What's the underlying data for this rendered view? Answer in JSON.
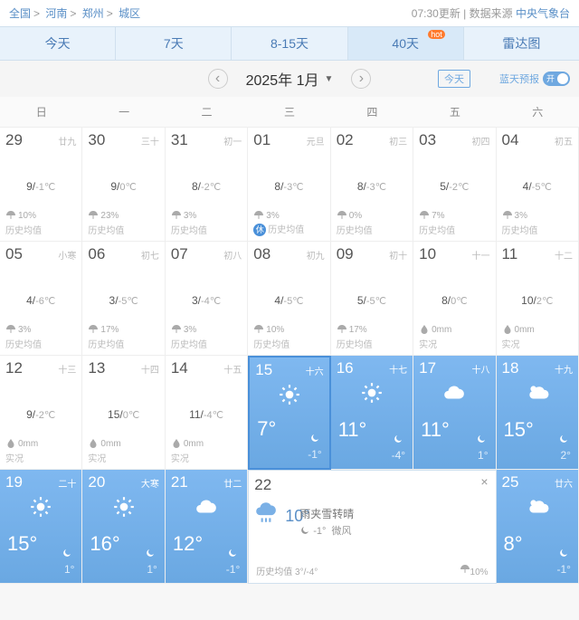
{
  "breadcrumbs": [
    "全国",
    "河南",
    "郑州",
    "城区"
  ],
  "update_time": "07:30更新",
  "source_label": "数据来源",
  "source": "中央气象台",
  "tabs": [
    "今天",
    "7天",
    "8-15天",
    "40天",
    "雷达图"
  ],
  "active_tab": 3,
  "hot_badge": "hot",
  "month_title": "2025年 1月",
  "today_btn": "今天",
  "bluesky_label": "蓝天预报",
  "toggle_state": "开",
  "weekdays": [
    "日",
    "一",
    "二",
    "三",
    "四",
    "五",
    "六"
  ],
  "hist_label": "历史均值",
  "actual_label": "实况",
  "cells": [
    {
      "d": "29",
      "lun": "廿九",
      "hi": "9",
      "lo": "-1",
      "r": "10%",
      "b": "历史均值"
    },
    {
      "d": "30",
      "lun": "三十",
      "hi": "9",
      "lo": "0",
      "r": "23%",
      "b": "历史均值"
    },
    {
      "d": "31",
      "lun": "初一",
      "hi": "8",
      "lo": "-2",
      "r": "3%",
      "b": "历史均值"
    },
    {
      "d": "01",
      "lun": "元旦",
      "hi": "8",
      "lo": "-3",
      "r": "3%",
      "b": "历史均值",
      "hol": "休"
    },
    {
      "d": "02",
      "lun": "初三",
      "hi": "8",
      "lo": "-3",
      "r": "0%",
      "b": "历史均值"
    },
    {
      "d": "03",
      "lun": "初四",
      "hi": "5",
      "lo": "-2",
      "r": "7%",
      "b": "历史均值"
    },
    {
      "d": "04",
      "lun": "初五",
      "hi": "4",
      "lo": "-5",
      "r": "3%",
      "b": "历史均值"
    },
    {
      "d": "05",
      "lun": "小寒",
      "hi": "4",
      "lo": "-6",
      "r": "3%",
      "b": "历史均值"
    },
    {
      "d": "06",
      "lun": "初七",
      "hi": "3",
      "lo": "-5",
      "r": "17%",
      "b": "历史均值"
    },
    {
      "d": "07",
      "lun": "初八",
      "hi": "3",
      "lo": "-4",
      "r": "3%",
      "b": "历史均值"
    },
    {
      "d": "08",
      "lun": "初九",
      "hi": "4",
      "lo": "-5",
      "r": "10%",
      "b": "历史均值"
    },
    {
      "d": "09",
      "lun": "初十",
      "hi": "5",
      "lo": "-5",
      "r": "17%",
      "b": "历史均值"
    },
    {
      "d": "10",
      "lun": "十一",
      "hi": "8",
      "lo": "0",
      "r": "0mm",
      "b": "实况",
      "drop": true
    },
    {
      "d": "11",
      "lun": "十二",
      "hi": "10",
      "lo": "2",
      "r": "0mm",
      "b": "实况",
      "drop": true
    },
    {
      "d": "12",
      "lun": "十三",
      "hi": "9",
      "lo": "-2",
      "r": "0mm",
      "b": "实况",
      "drop": true
    },
    {
      "d": "13",
      "lun": "十四",
      "hi": "15",
      "lo": "0",
      "r": "0mm",
      "b": "实况",
      "drop": true
    },
    {
      "d": "14",
      "lun": "十五",
      "hi": "11",
      "lo": "-4",
      "r": "0mm",
      "b": "实况",
      "drop": true
    }
  ],
  "blue_cells": [
    {
      "d": "15",
      "lun": "十六",
      "hi": "7°",
      "lo": "-1°",
      "icon": "sun",
      "today": true
    },
    {
      "d": "16",
      "lun": "十七",
      "hi": "11°",
      "lo": "-4°",
      "icon": "sun"
    },
    {
      "d": "17",
      "lun": "十八",
      "hi": "11°",
      "lo": "1°",
      "icon": "cloud"
    },
    {
      "d": "18",
      "lun": "十九",
      "hi": "15°",
      "lo": "2°",
      "icon": "partly"
    },
    {
      "d": "19",
      "lun": "二十",
      "hi": "15°",
      "lo": "1°",
      "icon": "sun"
    },
    {
      "d": "20",
      "lun": "大寒",
      "hi": "16°",
      "lo": "1°",
      "icon": "sun"
    },
    {
      "d": "21",
      "lun": "廿二",
      "hi": "12°",
      "lo": "-1°",
      "icon": "cloud"
    }
  ],
  "detail": {
    "d": "22",
    "hi": "10°",
    "lo": "-1°",
    "cond": "雨夹雪转晴",
    "wind": "微风",
    "hist": "历史均值 3°/-4°",
    "rain": "10%"
  },
  "last_cell": {
    "d": "25",
    "lun": "廿六",
    "hi": "8°",
    "lo": "-1°",
    "icon": "partly"
  }
}
